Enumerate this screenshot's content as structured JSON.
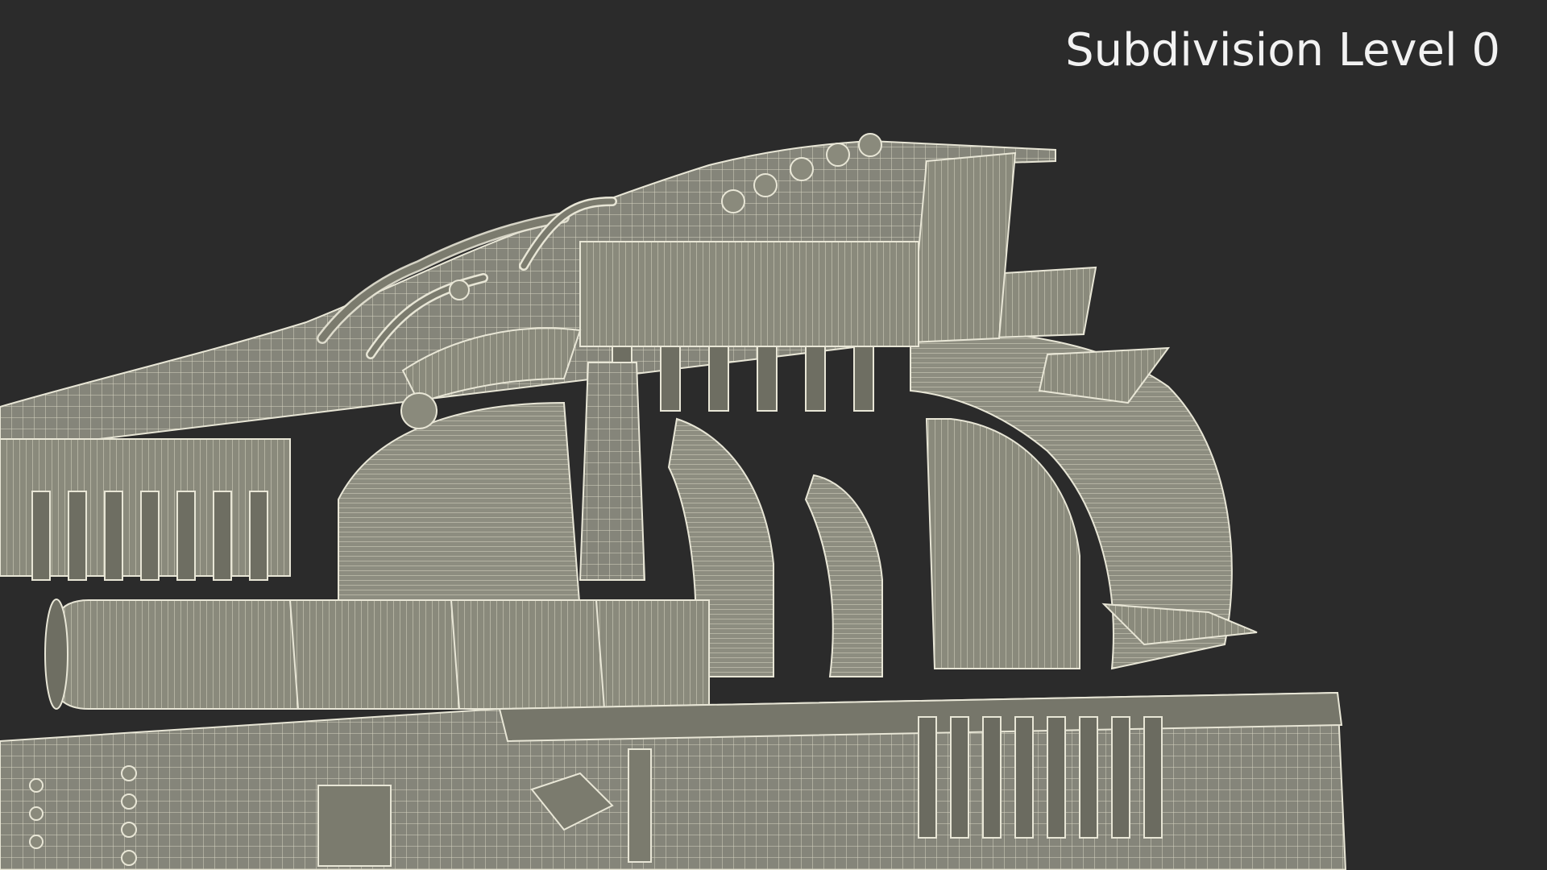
{
  "viewport": {
    "overlay_label": "Subdivision Level 0",
    "background_color": "#2b2b2b"
  },
  "model": {
    "subject": "turbine-engine-cutaway-wireframe",
    "surface_color": "#8a8a7c",
    "wire_color": "#e8e6d6",
    "shadow_color": "#5e5e54"
  }
}
